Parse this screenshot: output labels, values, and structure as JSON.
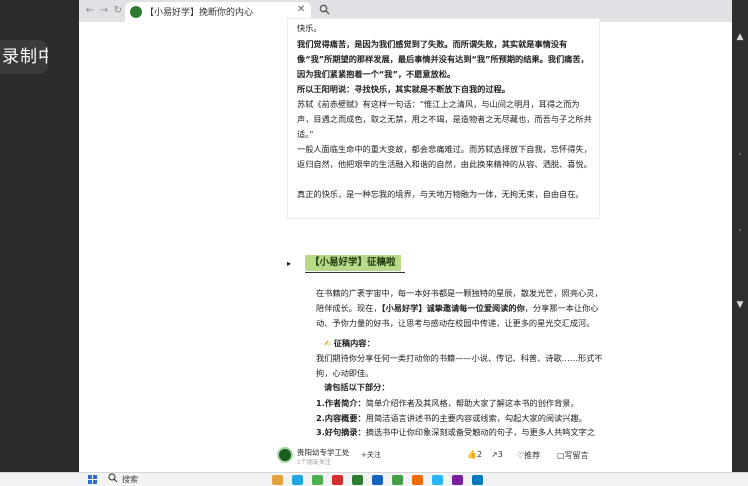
{
  "recorder": {
    "badge": "录制中"
  },
  "browser": {
    "tab_title": "【小易好学】挽断你的内心",
    "tab_close": "✕",
    "back": "←",
    "forward": "→",
    "reload": "↻"
  },
  "article": {
    "p1": "快乐。",
    "p2": "我们觉得痛苦，是因为我们感觉到了失败。而所谓失败，其实就是事情没有像“我”所期望的那样发展，最后事情并没有达到“我”所预期的结果。我们痛苦，因为我们紧紧抱着一个“我”，不愿意放松。",
    "p3": "所以王阳明说：寻找快乐，其实就是不断放下自我的过程。",
    "p4": "苏轼《前赤壁赋》有这样一句话：“惟江上之清风，与山间之明月，耳得之而为声，目遇之而成色，取之无禁，用之不竭，是造物者之无尽藏也，而吾与子之所共适。”",
    "p5": "一般人面临生命中的重大变故，都会悲痛难过。而苏轼选择放下自我，忘怀得失，返归自然，他把艰辛的生活融入和谐的自然，由此换来精神的从容、洒脱、喜悦。",
    "p6": "真正的快乐，是一种忘我的境界，与天地万物融为一体，无拘无束，自由自在。"
  },
  "section": {
    "arrow": "▸",
    "tag": "【小易好学】征稿啦",
    "p1_pre": "在书籍的广袤宇宙中，每一本好书都是一颗独特的星辰，散发光芒，照亮心灵，陪伴成长。现在，",
    "p1_bold": "【小易好学】诚挚邀请每一位爱阅读的你",
    "p1_post": "，分享那一本让你心动、予你力量的好书，让思考与感动在校园中传递，让更多的星光交汇成河。",
    "content_label": "征稿内容：",
    "content_emoji": "✍",
    "content_text": "我们期待你分享任何一类打动你的书籍——小说、传记、科普、诗歌……形式不拘，心动即佳。",
    "include_label": "请包括以下部分：",
    "item1_bold": "1.作者简介：",
    "item1_text": "简单介绍作者及其风格，帮助大家了解这本书的创作背景。",
    "item2_bold": "2.内容概要：",
    "item2_text": "用简洁语言讲述书的主要内容或线索，勾起大家的阅读兴趣。",
    "item3_bold": "3.好句摘录：",
    "item3_text": "摘选书中让你印象深刻或备受触动的句子，与更多人共鸣文字之美。"
  },
  "actionbar": {
    "account_name": "贵阳幼专学工处",
    "account_sub": "1个朋友关注",
    "follow": "+关注",
    "like_count": "2",
    "share_count": "3",
    "recommend": "推荐",
    "comment": "写留言"
  },
  "taskbar": {
    "search": "搜索"
  },
  "right_glyphs": [
    "▲",
    "▼",
    "·",
    "·"
  ]
}
